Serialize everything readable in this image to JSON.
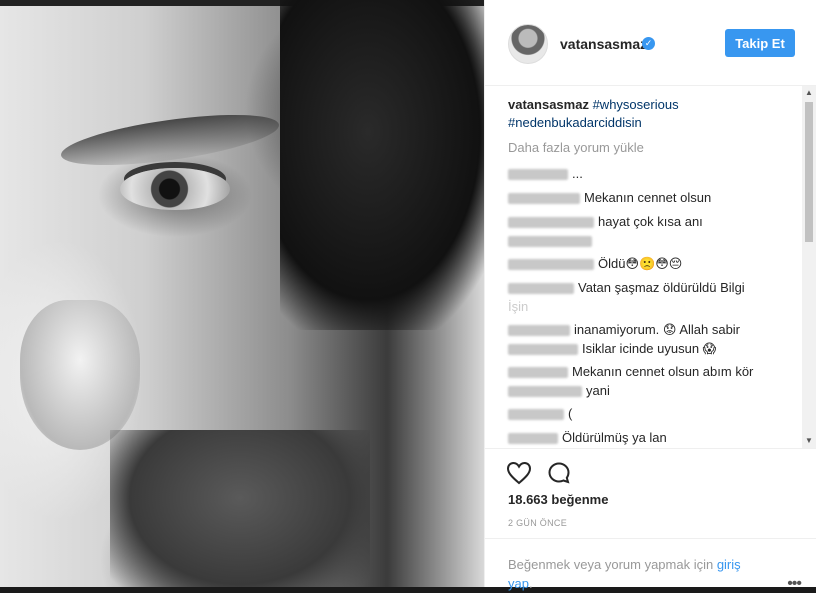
{
  "post": {
    "username": "vatansasmaz",
    "follow_label": "Takip Et",
    "caption_user": "vatansasmaz",
    "caption_tag1": "#whysoserious",
    "caption_tag2": "#nedenbukadarciddisin",
    "load_more": "Daha fazla yorum yükle",
    "likes": "18.663 beğenme",
    "time": "2 GÜN ÖNCE",
    "footer_text": "Beğenmek veya yorum yapmak için ",
    "login_link": "giriş yap",
    "footer_period": "."
  },
  "comments": [
    {
      "text": "..."
    },
    {
      "text": "Mekanın cennet olsun"
    },
    {
      "text": "hayat çok kısa anı"
    },
    {
      "text": ""
    },
    {
      "text": "Öldü😳🙁😳😔"
    },
    {
      "text": "Vatan şaşmaz öldürüldü Bilgi"
    },
    {
      "text": "İşin"
    },
    {
      "text": "inanamiyorum. 😟 Allah sabir"
    },
    {
      "text": "Isiklar icinde uyusun 😱"
    },
    {
      "text": "Mekanın cennet olsun abım kör"
    },
    {
      "text": "yani"
    },
    {
      "text": "("
    },
    {
      "text": "Öldürülmüş ya lan"
    }
  ],
  "icons": {
    "verified": "verified-badge-icon",
    "heart": "heart-icon",
    "comment": "comment-icon",
    "more": "more-options-icon"
  },
  "colors": {
    "accent": "#3897f0",
    "hashtag": "#003569",
    "muted": "#999999"
  }
}
